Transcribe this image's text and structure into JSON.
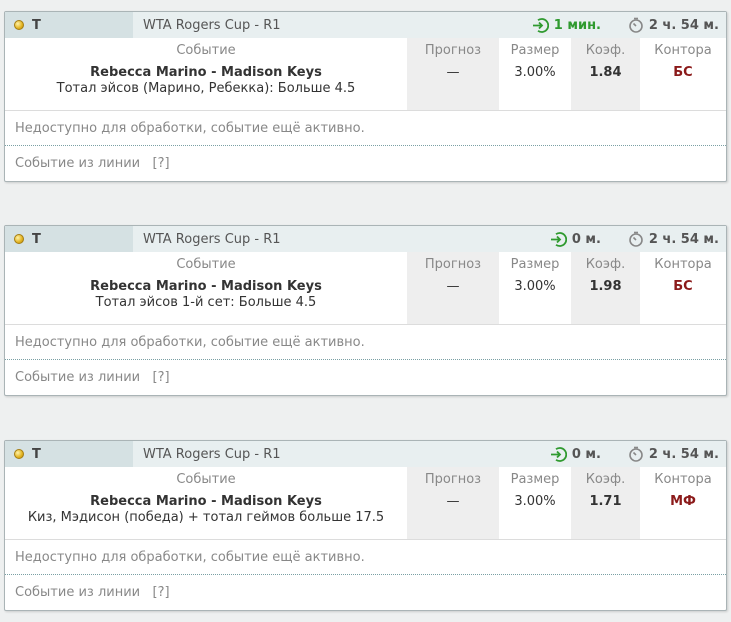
{
  "cards": [
    {
      "sport": "Т",
      "tournament": "WTA Rogers Cup - R1",
      "start_time": "1 мин.",
      "start_color": "green",
      "duration": "2 ч. 54 м.",
      "event_label": "Событие",
      "match": "Rebecca Marino - Madison Keys",
      "bet": "Тотал эйсов (Марино, Ребекка): Больше 4.5",
      "forecast_label": "Прогноз",
      "forecast": "—",
      "size_label": "Размер",
      "size": "3.00%",
      "coef_label": "Коэф.",
      "coef": "1.84",
      "book_label": "Контора",
      "book": "БС",
      "status": "Недоступно для обработки, событие ещё активно.",
      "source": "Событие из линии   [?]"
    },
    {
      "sport": "Т",
      "tournament": "WTA Rogers Cup - R1",
      "start_time": "0 м.",
      "start_color": "gray",
      "duration": "2 ч. 54 м.",
      "event_label": "Событие",
      "match": "Rebecca Marino - Madison Keys",
      "bet": "Тотал эйсов 1-й сет: Больше 4.5",
      "forecast_label": "Прогноз",
      "forecast": "—",
      "size_label": "Размер",
      "size": "3.00%",
      "coef_label": "Коэф.",
      "coef": "1.98",
      "book_label": "Контора",
      "book": "БС",
      "status": "Недоступно для обработки, событие ещё активно.",
      "source": "Событие из линии   [?]"
    },
    {
      "sport": "Т",
      "tournament": "WTA Rogers Cup - R1",
      "start_time": "0 м.",
      "start_color": "gray",
      "duration": "2 ч. 54 м.",
      "event_label": "Событие",
      "match": "Rebecca Marino - Madison Keys",
      "bet": "Киз, Мэдисон (победа) + тотал геймов больше 17.5",
      "forecast_label": "Прогноз",
      "forecast": "—",
      "size_label": "Размер",
      "size": "3.00%",
      "coef_label": "Коэф.",
      "coef": "1.71",
      "book_label": "Контора",
      "book": "МФ",
      "status": "Недоступно для обработки, событие ещё активно.",
      "source": "Событие из линии   [?]"
    }
  ]
}
